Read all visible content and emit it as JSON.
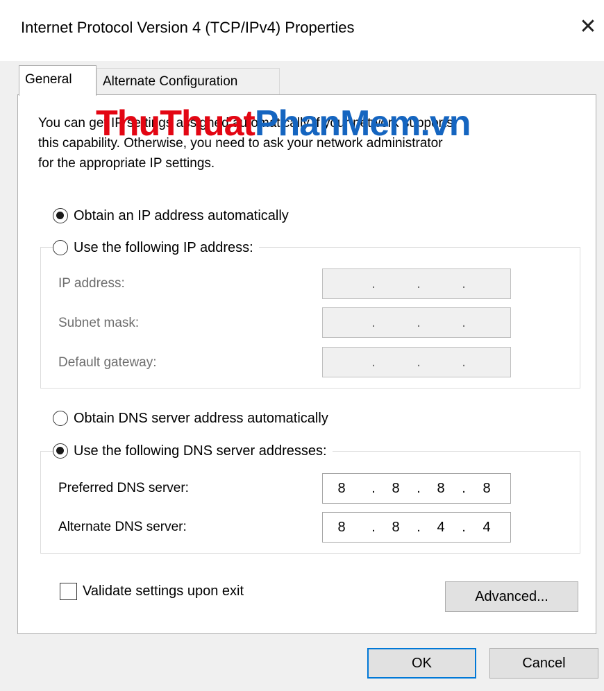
{
  "window": {
    "title": "Internet Protocol Version 4 (TCP/IPv4) Properties",
    "close_symbol": "✕"
  },
  "tabs": [
    {
      "label": "General",
      "selected": true
    },
    {
      "label": "Alternate Configuration",
      "selected": false
    }
  ],
  "intro": {
    "line1": "You can get IP settings assigned automatically if your network supports",
    "line2": "this capability. Otherwise, you need to ask your network administrator",
    "line3": "for the appropriate IP settings."
  },
  "watermark": {
    "part1": "ThuThuat",
    "part2": "PhanMem.vn"
  },
  "ip": {
    "auto_label": "Obtain an IP address automatically",
    "auto_selected": true,
    "manual_label": "Use the following IP address:",
    "manual_selected": false,
    "fields": [
      {
        "label": "IP address:",
        "value": [
          "",
          "",
          "",
          ""
        ]
      },
      {
        "label": "Subnet mask:",
        "value": [
          "",
          "",
          "",
          ""
        ]
      },
      {
        "label": "Default gateway:",
        "value": [
          "",
          "",
          "",
          ""
        ]
      }
    ]
  },
  "dns": {
    "auto_label": "Obtain DNS server address automatically",
    "auto_selected": false,
    "manual_label": "Use the following DNS server addresses:",
    "manual_selected": true,
    "fields": [
      {
        "label": "Preferred DNS server:",
        "value": [
          "8",
          "8",
          "8",
          "8"
        ]
      },
      {
        "label": "Alternate DNS server:",
        "value": [
          "8",
          "8",
          "4",
          "4"
        ]
      }
    ]
  },
  "validate": {
    "label": "Validate settings upon exit",
    "checked": false
  },
  "buttons": {
    "advanced": "Advanced...",
    "ok": "OK",
    "cancel": "Cancel"
  },
  "colors": {
    "watermark_red": "#e30613",
    "watermark_blue": "#1565c0",
    "focus_border": "#0078d7"
  },
  "icons": {
    "close": "close-icon",
    "radio": "radio-button",
    "checkbox": "checkbox"
  }
}
